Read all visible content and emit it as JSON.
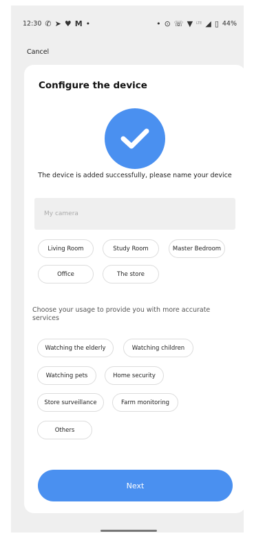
{
  "status_bar": {
    "time": "12:30",
    "left_icons": [
      "whatsapp-icon",
      "telegram-icon",
      "chat-icon",
      "gmail-icon",
      "dot-icon"
    ],
    "right_icons": [
      "dot-icon",
      "location-icon",
      "wifi-call-icon",
      "wifi-icon",
      "signal-icon",
      "battery-icon"
    ],
    "network_label": "LTE",
    "battery": "44%"
  },
  "header": {
    "cancel_label": "Cancel"
  },
  "card": {
    "title": "Configure the device",
    "success_message": "The device is added successfully, please name your device",
    "name_input": {
      "placeholder": "My camera",
      "value": ""
    },
    "room_chips": [
      "Living Room",
      "Study Room",
      "Master Bedroom",
      "Office",
      "The store"
    ],
    "usage_prompt": "Choose your usage to provide you with more accurate services",
    "usage_chips": [
      "Watching the elderly",
      "Watching children",
      "Watching pets",
      "Home security",
      "Store surveillance",
      "Farm monitoring",
      "Others"
    ],
    "next_label": "Next"
  },
  "colors": {
    "accent": "#4a90f0",
    "background": "#efefef",
    "card": "#ffffff"
  }
}
